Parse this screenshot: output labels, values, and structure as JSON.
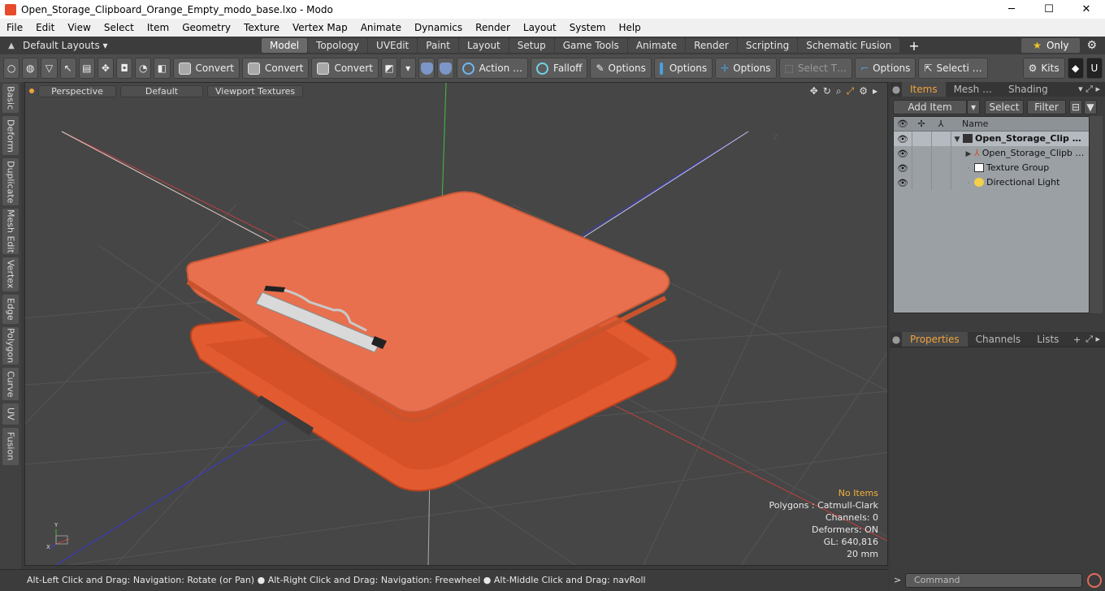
{
  "window": {
    "title": "Open_Storage_Clipboard_Orange_Empty_modo_base.lxo - Modo",
    "minimize": "─",
    "maximize": "☐",
    "close": "✕"
  },
  "menu": [
    "File",
    "Edit",
    "View",
    "Select",
    "Item",
    "Geometry",
    "Texture",
    "Vertex Map",
    "Animate",
    "Dynamics",
    "Render",
    "Layout",
    "System",
    "Help"
  ],
  "layout_bar": {
    "layouts_label": "Default Layouts ▾",
    "tabs": [
      "Model",
      "Topology",
      "UVEdit",
      "Paint",
      "Layout",
      "Setup",
      "Game Tools",
      "Animate",
      "Render",
      "Scripting",
      "Schematic Fusion"
    ],
    "active_tab": "Model",
    "only_label": "Only",
    "add": "+"
  },
  "toolbar": {
    "convert1": "Convert",
    "convert2": "Convert",
    "convert3": "Convert",
    "action": "Action",
    "falloff": "Falloff",
    "options1": "Options",
    "options2": "Options",
    "options3": "Options",
    "select_t": "Select T…",
    "options4": "Options",
    "selecti": "Selecti …",
    "kits": "Kits"
  },
  "left_tabs": [
    "Basic",
    "Deform",
    "Duplicate",
    "Mesh Edit",
    "Vertex",
    "Edge",
    "Polygon",
    "Curve",
    "UV",
    "Fusion"
  ],
  "viewport": {
    "view_btn": "Perspective",
    "shade_btn": "Default",
    "tex_btn": "Viewport Textures",
    "axis_z_label": "Z",
    "stats": [
      "No Items",
      "Polygons : Catmull-Clark",
      "Channels: 0",
      "Deformers: ON",
      "GL: 640,816",
      "20 mm"
    ],
    "gizmo": {
      "y": "Y",
      "x": "X"
    }
  },
  "items_panel": {
    "tabs": [
      "Items",
      "Mesh …",
      "Shading"
    ],
    "active_tab": "Items",
    "add_item": "Add Item",
    "select": "Select",
    "filter": "Filter",
    "column_name": "Name",
    "rows": [
      {
        "name": "Open_Storage_Clip …",
        "bold": true
      },
      {
        "name": "Open_Storage_Clipb …"
      },
      {
        "name": "Texture Group"
      },
      {
        "name": "Directional Light"
      }
    ]
  },
  "props_panel": {
    "tabs": [
      "Properties",
      "Channels",
      "Lists"
    ],
    "active_tab": "Properties",
    "add": "+"
  },
  "status_bar": {
    "text": "Alt-Left Click and Drag: Navigation: Rotate (or Pan) ● Alt-Right Click and Drag: Navigation: Freewheel ● Alt-Middle Click and Drag: navRoll"
  },
  "command": {
    "placeholder": "Command",
    "prompt": ">"
  },
  "colors": {
    "accent": "#f0a23a",
    "clipboard": "#e8704f",
    "clip_metal": "#d9d9d9"
  }
}
